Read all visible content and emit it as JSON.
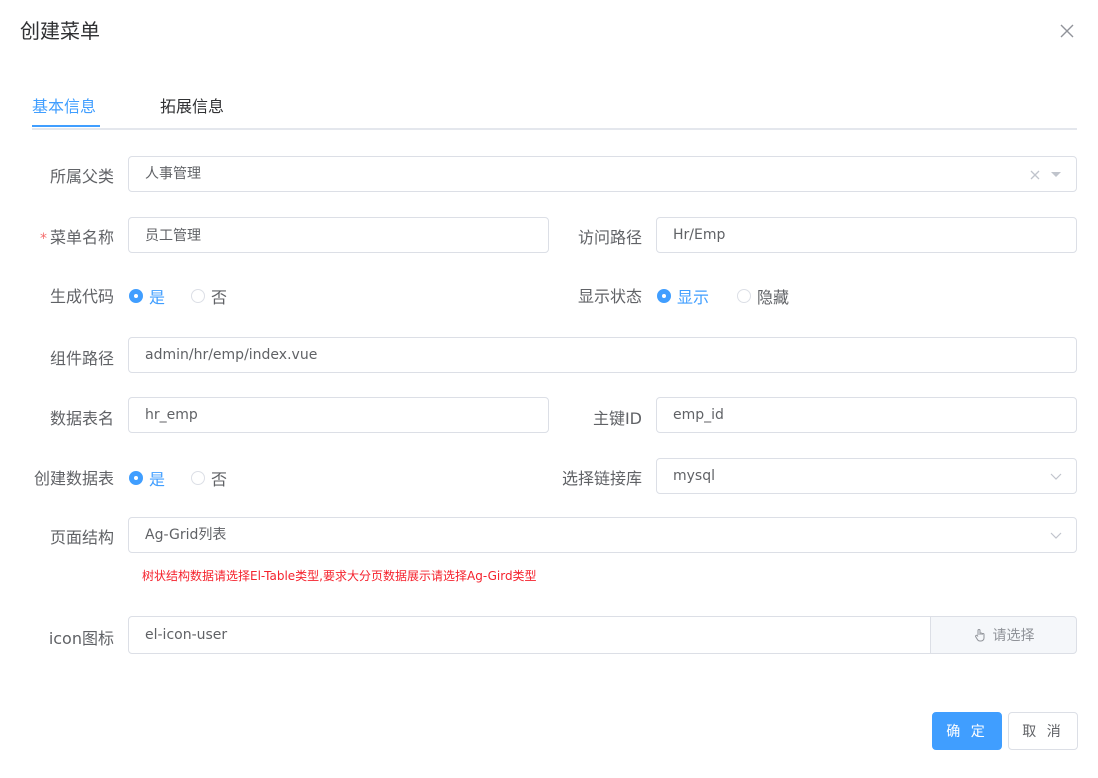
{
  "dialog": {
    "title": "创建菜单"
  },
  "tabs": [
    {
      "label": "基本信息",
      "active": true
    },
    {
      "label": "拓展信息",
      "active": false
    }
  ],
  "form": {
    "parent": {
      "label": "所属父类",
      "value": "人事管理"
    },
    "menu_name": {
      "label": "菜单名称",
      "value": "员工管理",
      "required_mark": "*"
    },
    "access_path": {
      "label": "访问路径",
      "value": "Hr/Emp"
    },
    "generate_code": {
      "label": "生成代码",
      "options": [
        "是",
        "否"
      ],
      "selected": "是"
    },
    "display_status": {
      "label": "显示状态",
      "options": [
        "显示",
        "隐藏"
      ],
      "selected": "显示"
    },
    "component_path": {
      "label": "组件路径",
      "value": "admin/hr/emp/index.vue"
    },
    "table_name": {
      "label": "数据表名",
      "value": "hr_emp"
    },
    "primary_key": {
      "label": "主键ID",
      "value": "emp_id"
    },
    "create_table": {
      "label": "创建数据表",
      "options": [
        "是",
        "否"
      ],
      "selected": "是"
    },
    "db_link": {
      "label": "选择链接库",
      "value": "mysql"
    },
    "page_structure": {
      "label": "页面结构",
      "value": "Ag-Grid列表",
      "hint": "树状结构数据请选择El-Table类型,要求大分页数据展示请选择Ag-Gird类型"
    },
    "icon": {
      "label": "icon图标",
      "value": "el-icon-user",
      "button_label": "请选择"
    }
  },
  "footer": {
    "confirm_label": "确 定",
    "cancel_label": "取 消"
  },
  "colors": {
    "primary": "#409eff",
    "danger": "#f5222d",
    "text": "#606266",
    "border": "#dcdfe6"
  },
  "icons": {
    "close": "close-icon",
    "clear": "clear-icon",
    "arrow": "chevron-down-icon",
    "pointer": "hand-pointer-icon"
  }
}
